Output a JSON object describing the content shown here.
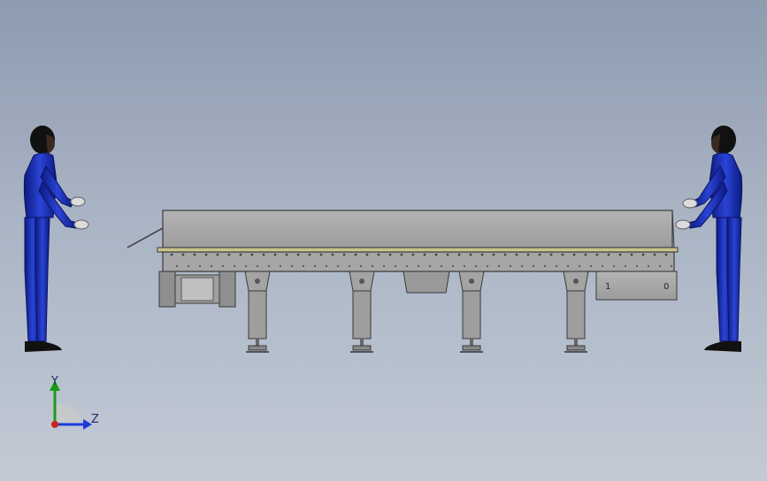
{
  "viewport": {
    "background_top": "#8e9bb0",
    "background_bottom": "#c2cad5"
  },
  "machine": {
    "body_color": "#a8a8a8",
    "edge_color": "#3a3a3a",
    "panel_labels": [
      "1",
      "0"
    ]
  },
  "figures": {
    "suit_color": "#1a2fb0",
    "head_color": "#111111",
    "glove_color": "#dcdcdc"
  },
  "triad": {
    "y_label": "Y",
    "z_label": "Z",
    "y_color": "#1a9a1a",
    "z_color": "#1e3bd8",
    "origin_color": "#d02020"
  }
}
